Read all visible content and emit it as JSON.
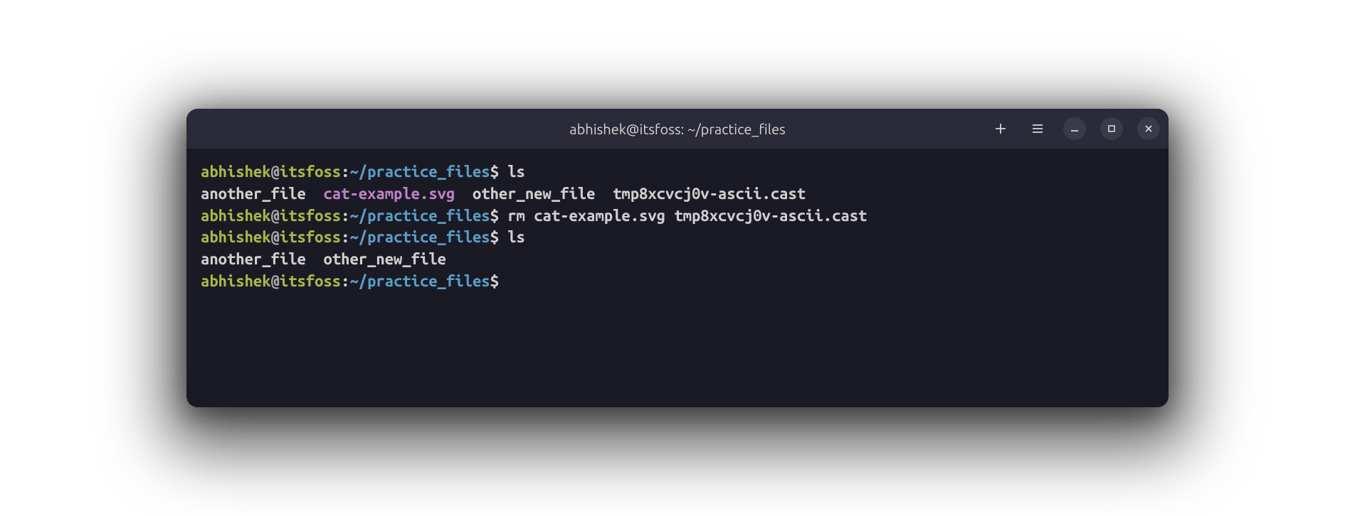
{
  "titlebar": {
    "title": "abhishek@itsfoss: ~/practice_files"
  },
  "prompt": {
    "user": "abhishek",
    "at": "@",
    "host": "itsfoss",
    "colon": ":",
    "path": "~/practice_files",
    "dollar": "$"
  },
  "lines": {
    "cmd1": " ls",
    "out1_file1": "another_file",
    "out1_gap1": "  ",
    "out1_file2": "cat-example.svg",
    "out1_gap2": "  ",
    "out1_file3": "other_new_file",
    "out1_gap3": "  ",
    "out1_file4": "tmp8xcvcj0v-ascii.cast",
    "cmd2": " rm cat-example.svg tmp8xcvcj0v-ascii.cast",
    "cmd3": " ls",
    "out2_file1": "another_file",
    "out2_gap1": "  ",
    "out2_file2": "other_new_file",
    "cmd4": " "
  }
}
